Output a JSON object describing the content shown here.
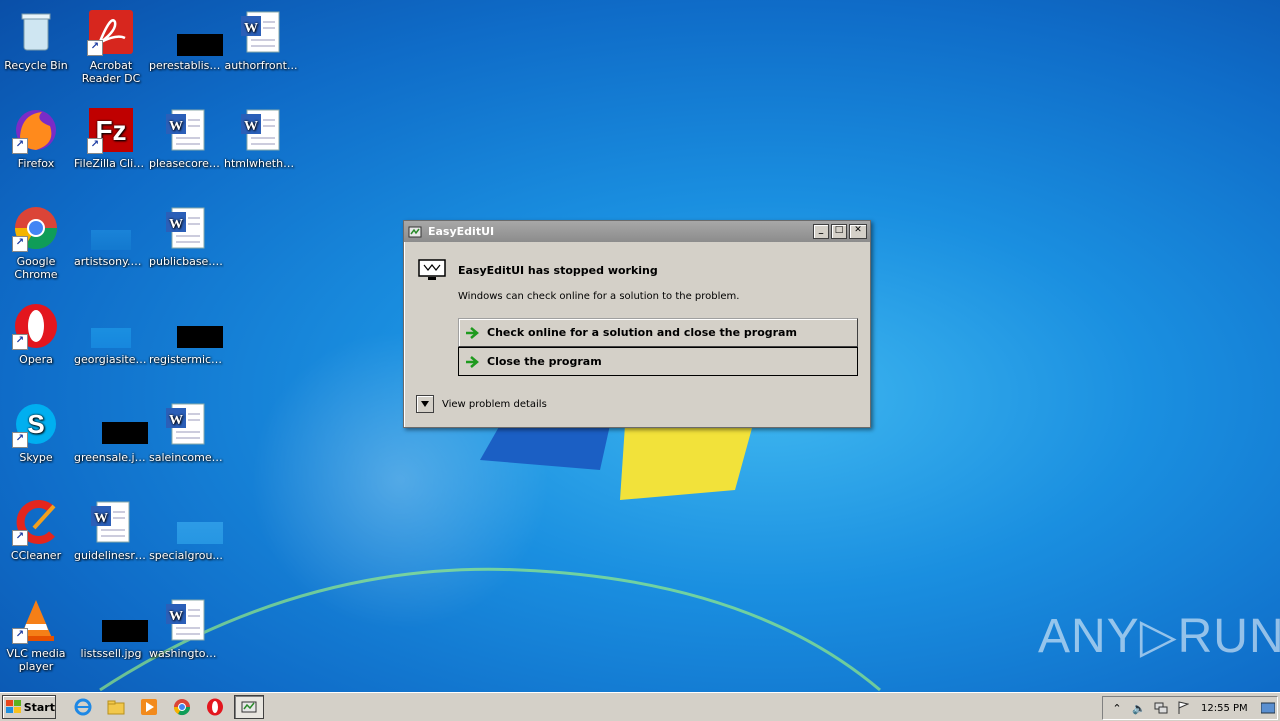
{
  "desktop": {
    "icons": [
      {
        "label": "Recycle Bin"
      },
      {
        "label": "Acrobat Reader DC"
      },
      {
        "label": "perestablish..."
      },
      {
        "label": "authorfront..."
      },
      {
        "label": "Firefox"
      },
      {
        "label": "FileZilla Client"
      },
      {
        "label": "pleasecore.rtf"
      },
      {
        "label": "htmlwhethe..."
      },
      {
        "label": "Google Chrome"
      },
      {
        "label": "artistsony.png"
      },
      {
        "label": "publicbase.rtf"
      },
      {
        "label": "Opera"
      },
      {
        "label": "georgiasite...."
      },
      {
        "label": "registermich..."
      },
      {
        "label": "Skype"
      },
      {
        "label": "greensale.jpg"
      },
      {
        "label": "saleincome.rtf"
      },
      {
        "label": "CCleaner"
      },
      {
        "label": "guidelinesra..."
      },
      {
        "label": "specialgrou..."
      },
      {
        "label": "VLC media player"
      },
      {
        "label": "listssell.jpg"
      },
      {
        "label": "washington...."
      }
    ]
  },
  "dialog": {
    "title": "EasyEditUI",
    "heading": "EasyEditUI has stopped working",
    "message": "Windows can check online for a solution to the problem.",
    "option_check_online": "Check online for a solution and close the program",
    "option_close": "Close the program",
    "details_label": "View problem details",
    "btn_minimize": "_",
    "btn_maximize": "□",
    "btn_close": "✕"
  },
  "taskbar": {
    "start_label": "Start",
    "clock": "12:55 PM"
  },
  "watermark": "ANY▷RUN"
}
